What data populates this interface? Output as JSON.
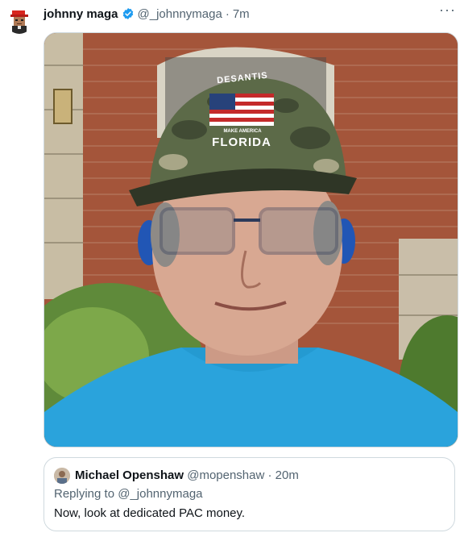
{
  "tweet": {
    "author_name": "johnny maga",
    "author_handle": "@_johnnymaga",
    "separator": "·",
    "time": "7m",
    "more_label": "···",
    "photo": {
      "hat_text_top": "DESANTIS",
      "hat_text_mid": "MAKE AMERICA",
      "hat_text_bottom": "FLORIDA"
    }
  },
  "quote": {
    "author_name": "Michael Openshaw",
    "author_handle": "@mopenshaw",
    "separator": "·",
    "time": "20m",
    "replying_to": "Replying to @_johnnymaga",
    "text": "Now, look at dedicated PAC money."
  },
  "colors": {
    "text_primary": "#0f1419",
    "text_secondary": "#536471",
    "verified_blue": "#1d9bf0",
    "border": "#cfd9de"
  },
  "icons": [
    "avatar",
    "verified-badge-icon",
    "more-icon"
  ]
}
